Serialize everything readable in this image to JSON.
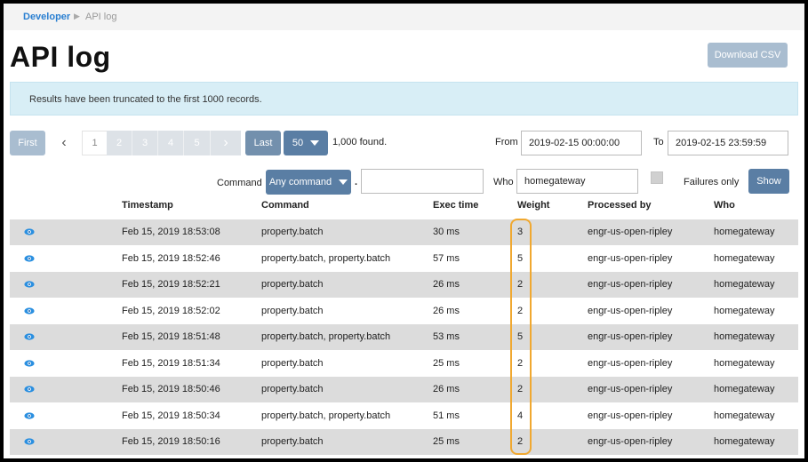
{
  "breadcrumb": {
    "parent": "Developer",
    "current": "API log"
  },
  "page": {
    "title": "API log",
    "download_label": "Download CSV"
  },
  "alert": {
    "message": "Results have been truncated to the first 1000 records."
  },
  "pagination": {
    "first": "First",
    "pages": [
      "1",
      "2",
      "3",
      "4",
      "5"
    ],
    "last": "Last",
    "page_size": "50",
    "found": "1,000 found."
  },
  "filters": {
    "from_label": "From",
    "from_value": "2019-02-15 00:00:00",
    "to_label": "To",
    "to_value": "2019-02-15 23:59:59",
    "command_label": "Command",
    "command_select": "Any command",
    "command_separator": ".",
    "command_value": "",
    "who_label": "Who",
    "who_value": "homegateway",
    "failures_label": "Failures only",
    "show_label": "Show"
  },
  "table": {
    "headers": [
      "Timestamp",
      "Command",
      "Exec time",
      "Weight",
      "Processed by",
      "Who"
    ],
    "rows": [
      [
        "Feb 15, 2019 18:53:08",
        "property.batch",
        "30 ms",
        "3",
        "engr-us-open-ripley",
        "homegateway"
      ],
      [
        "Feb 15, 2019 18:52:46",
        "property.batch, property.batch",
        "57 ms",
        "5",
        "engr-us-open-ripley",
        "homegateway"
      ],
      [
        "Feb 15, 2019 18:52:21",
        "property.batch",
        "26 ms",
        "2",
        "engr-us-open-ripley",
        "homegateway"
      ],
      [
        "Feb 15, 2019 18:52:02",
        "property.batch",
        "26 ms",
        "2",
        "engr-us-open-ripley",
        "homegateway"
      ],
      [
        "Feb 15, 2019 18:51:48",
        "property.batch, property.batch",
        "53 ms",
        "5",
        "engr-us-open-ripley",
        "homegateway"
      ],
      [
        "Feb 15, 2019 18:51:34",
        "property.batch",
        "25 ms",
        "2",
        "engr-us-open-ripley",
        "homegateway"
      ],
      [
        "Feb 15, 2019 18:50:46",
        "property.batch",
        "26 ms",
        "2",
        "engr-us-open-ripley",
        "homegateway"
      ],
      [
        "Feb 15, 2019 18:50:34",
        "property.batch, property.batch",
        "51 ms",
        "4",
        "engr-us-open-ripley",
        "homegateway"
      ],
      [
        "Feb 15, 2019 18:50:16",
        "property.batch",
        "25 ms",
        "2",
        "engr-us-open-ripley",
        "homegateway"
      ]
    ]
  },
  "colors": {
    "link": "#2a7fd1",
    "primary_button": "#5a7ea4",
    "highlight": "#f0a830",
    "row_stripe": "#dcdcdc"
  },
  "icons": {
    "row_action": "eye-icon"
  }
}
